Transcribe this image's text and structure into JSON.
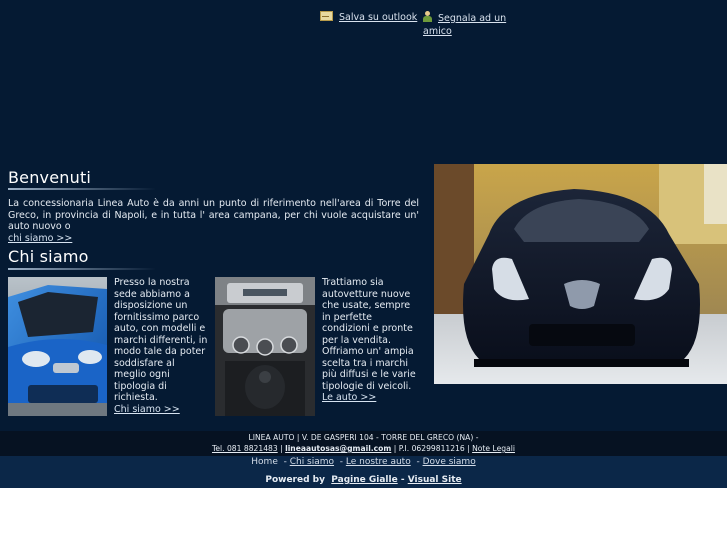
{
  "header": {
    "save_outlook": "Salva su outlook",
    "recommend_friend_line1": "Segnala ad un",
    "recommend_friend_line2": "amico"
  },
  "welcome": {
    "title": "Benvenuti",
    "text": "La concessionaria Linea Auto è da anni un punto di riferimento nell'area di Torre del Greco, in provincia di Napoli, e in tutta l' area campana, per chi vuole acquistare un' auto nuovo o",
    "link": "chi siamo >>"
  },
  "about": {
    "title": "Chi siamo",
    "col1_text": "Presso la nostra sede abbiamo a disposizione un fornitissimo parco auto, con modelli e marchi differenti, in modo tale da poter soddisfare al meglio ogni tipologia di richiesta.",
    "col1_link": "Chi siamo >>",
    "col2_text1": "Trattiamo sia autovetture nuove che usate, sempre in perfette condizioni e pronte per la vendita.",
    "col2_text2": "Offriamo un' ampia scelta tra i marchi più diffusi e le varie tipologie di veicoli.",
    "col2_link": "Le auto >>"
  },
  "footer": {
    "line1": "LINEA AUTO | V. DE GASPERI 104 - TORRE DEL GRECO (NA) -",
    "tel": "Tel. 081 8821483",
    "sep1": " | ",
    "email": "lineaautosas@gmail.com",
    "piva": " | P.I. 06299811216 | ",
    "notes": "Note Legali"
  },
  "nav": {
    "home": "Home",
    "chi_siamo": "Chi siamo",
    "le_nostre_auto": "Le nostre auto",
    "dove_siamo": "Dove siamo",
    "powered_by": "Powered by",
    "pagine_gialle": "Pagine Gialle",
    "dash": " - ",
    "visual_site": "Visual Site"
  },
  "colors": {
    "background": "#051a33",
    "footer_dark": "#061222",
    "nav_bar": "#0b2748"
  },
  "icons": {
    "save_outlook": "envelope-icon",
    "recommend_friend": "person-icon"
  }
}
